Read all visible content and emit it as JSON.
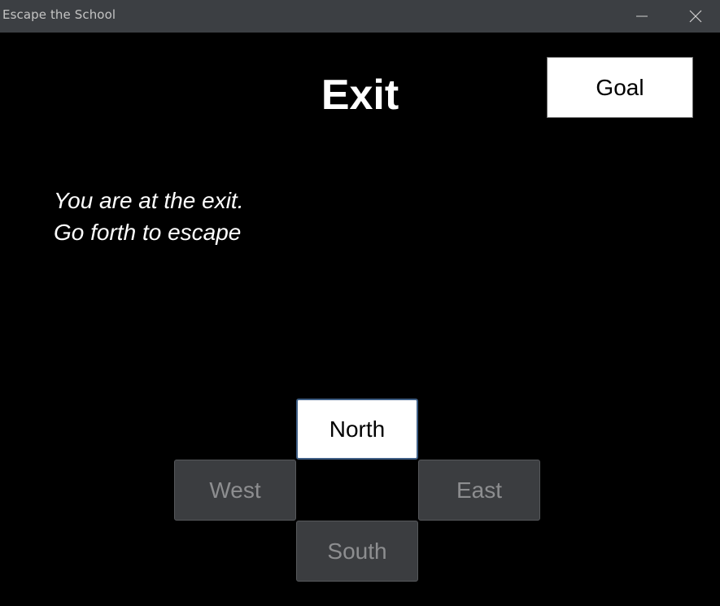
{
  "window": {
    "title": "Escape the School",
    "minimize_icon": "minimize-icon",
    "close_icon": "close-icon"
  },
  "room": {
    "name": "Exit",
    "description_line1": "You are at the exit.",
    "description_line2": "Go forth to escape"
  },
  "goal_button": {
    "label": "Goal"
  },
  "navigation": {
    "north": {
      "label": "North",
      "enabled": true
    },
    "west": {
      "label": "West",
      "enabled": false
    },
    "east": {
      "label": "East",
      "enabled": false
    },
    "south": {
      "label": "South",
      "enabled": false
    }
  },
  "colors": {
    "background": "#000000",
    "titlebar": "#3c3f43",
    "active_button_bg": "#ffffff",
    "active_button_border": "#3f5f86",
    "disabled_button_bg": "#3b3d40",
    "disabled_text": "#8d8e90"
  }
}
